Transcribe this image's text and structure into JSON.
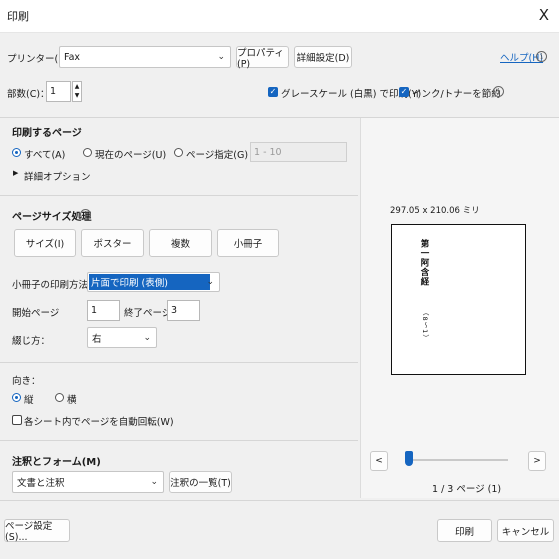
{
  "window": {
    "title": "印刷",
    "close": "X"
  },
  "printer": {
    "label": "プリンター(N)：",
    "value": "Fax",
    "properties_label": "プロパティ(P)",
    "advanced_label": "詳細設定(D)",
    "help_label": "ヘルプ(H)"
  },
  "copies": {
    "label": "部数(C)：",
    "value": "1"
  },
  "options": {
    "grayscale_label": "グレースケール (白黒) で印刷(Y)",
    "grayscale_checked": true,
    "save_ink_label": "インク/トナーを節約",
    "save_ink_checked": true
  },
  "pages": {
    "title": "印刷するページ",
    "all_label": "すべて(A)",
    "current_label": "現在のページ(U)",
    "range_label": "ページ指定(G)",
    "range_value": "1 - 10",
    "selected": "all",
    "more_options": "詳細オプション"
  },
  "page_handling": {
    "title": "ページサイズ処理",
    "buttons": [
      "サイズ(I)",
      "ポスター",
      "複数",
      "小冊子"
    ],
    "booklet_method_label": "小冊子の印刷方法：",
    "booklet_method_value": "片面で印刷 (表側)",
    "start_label": "開始ページ",
    "start_value": "1",
    "end_label": "終了ページ",
    "end_value": "3",
    "binding_label": "綴じ方：",
    "binding_value": "右"
  },
  "orientation": {
    "title": "向き：",
    "portrait_label": "縦",
    "landscape_label": "横",
    "selected": "portrait",
    "auto_rotate_label": "各シート内でページを自動回転(W)",
    "auto_rotate_checked": false
  },
  "comments": {
    "title": "注釈とフォーム(M)",
    "value": "文書と注釈",
    "summary_label": "注釈の一覧(T)"
  },
  "preview": {
    "size_text": "297.05 x 210.06 ミリ",
    "page_heading": "第一阿含経",
    "page_sub": "（8～1）",
    "prev": "<",
    "next": ">",
    "page_status": "1 / 3 ページ (1)",
    "slider_position": 0
  },
  "footer": {
    "page_setup_label": "ページ設定(S)...",
    "print_label": "印刷",
    "cancel_label": "キャンセル"
  },
  "colors": {
    "accent": "#1565c0",
    "selection": "#1565c0"
  }
}
